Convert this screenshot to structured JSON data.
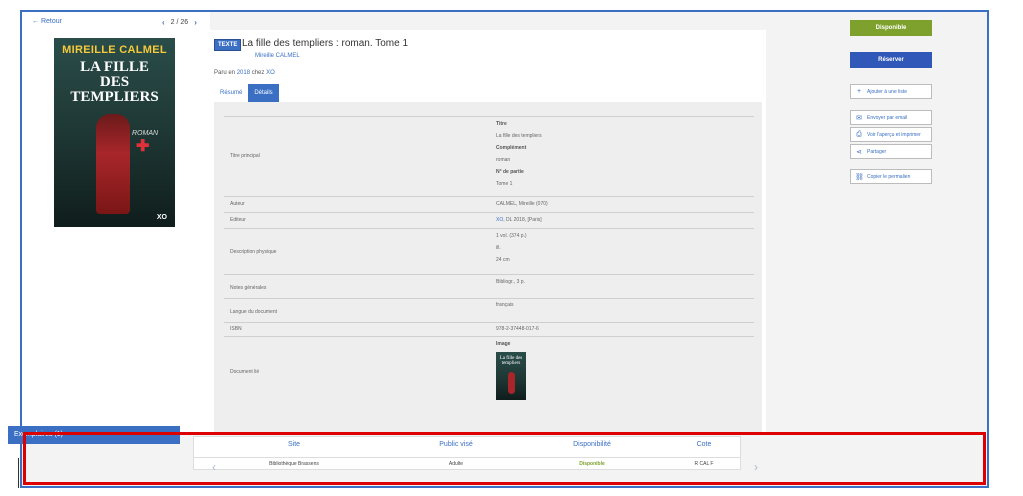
{
  "nav": {
    "back_label": "← Retour",
    "page_indicator": "2 / 26"
  },
  "cover": {
    "author": "MIREILLE CALMEL",
    "title_line1": "LA FILLE",
    "title_line2": "DES",
    "title_line3": "TEMPLIERS",
    "genre": "ROMAN",
    "publisher": "XO"
  },
  "book": {
    "type_badge": "TEXTE",
    "title": "La fille des templiers : roman. Tome 1",
    "author": "Mireille CALMEL",
    "pub_prefix": "Paru en",
    "pub_year": "2018",
    "pub_mid": "chez",
    "pub_publisher": "XO"
  },
  "tabs": {
    "resume": "Résumé",
    "details": "Détails"
  },
  "details": {
    "titre_principal": {
      "label": "Titre principal",
      "h_titre": "Titre",
      "titre": "La fille des templiers",
      "h_complement": "Complément",
      "complement": "roman",
      "h_partie": "N° de partie",
      "partie": "Tome 1"
    },
    "auteur": {
      "label": "Auteur",
      "value": "CALMEL, Mireille (070)"
    },
    "editeur": {
      "label": "Editeur",
      "link": "XO",
      "rest": ", DL 2018, [Paris]"
    },
    "description": {
      "label": "Description physique",
      "v1": "1 vol. (374 p.)",
      "v2": "ill.",
      "v3": "24 cm"
    },
    "notes": {
      "label": "Notes générales",
      "value": "Bibliogr., 3 p."
    },
    "langue": {
      "label": "Langue du document",
      "value": "français"
    },
    "isbn": {
      "label": "ISBN",
      "value": "978-2-37448-017-6"
    },
    "document_lie": {
      "label": "Document lié",
      "h_image": "Image",
      "thumb_title": "La fille des templiers"
    }
  },
  "actions": {
    "disponible": "Disponible",
    "reserver": "Réserver",
    "ajouter_liste": "Ajouter à une liste",
    "envoyer_email": "Envoyer par email",
    "apercu_imprimer": "Voir l'aperçu et imprimer",
    "partager": "Partager",
    "copier_permalien": "Copier le permalien"
  },
  "exemplaires": {
    "tab_label": "Exemplaires (1)",
    "headers": [
      "Site",
      "Public visé",
      "Disponibilité",
      "Cote"
    ],
    "rows": [
      {
        "site": "Bibliothèque Brassens",
        "public": "Adulte",
        "dispo": "Disponible",
        "cote": "R CAL F"
      }
    ]
  },
  "colors": {
    "accent": "#3a6fc4",
    "available": "#7ea12d",
    "reserve": "#2f58b8",
    "highlight": "#dd0000"
  }
}
